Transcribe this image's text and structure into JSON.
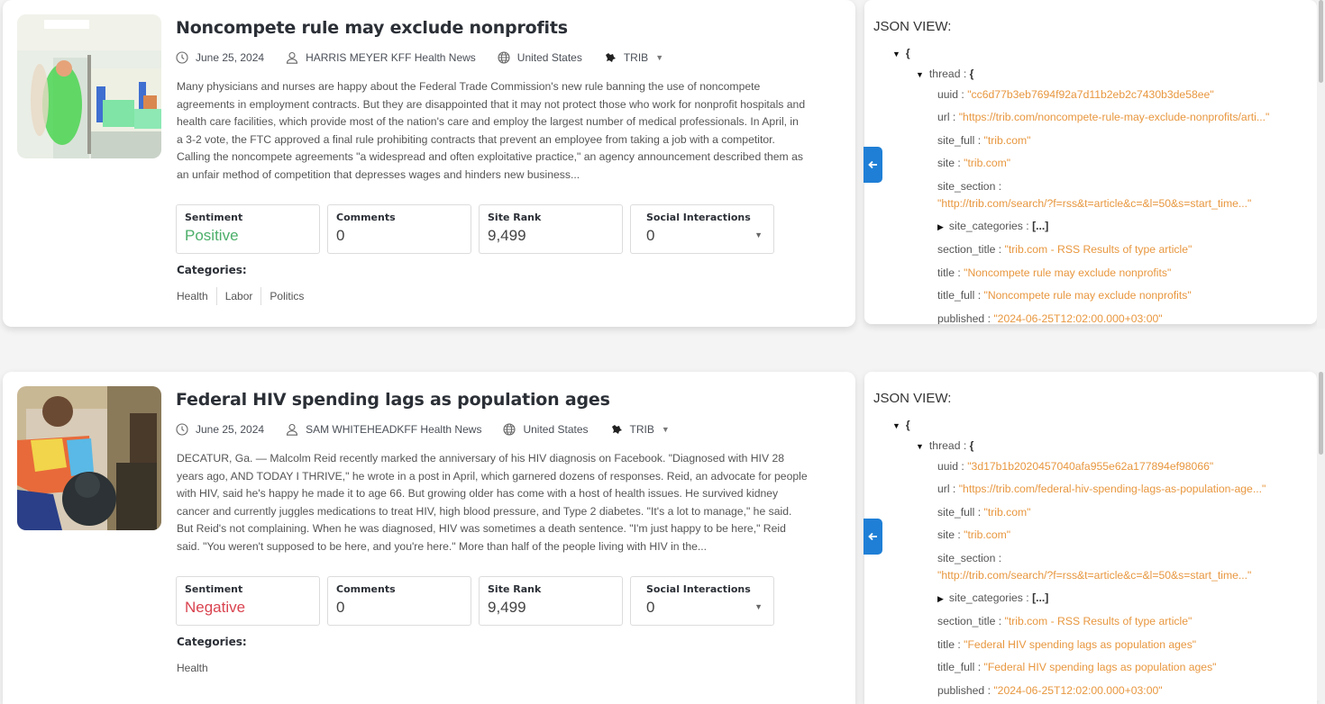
{
  "articles": [
    {
      "title": "Noncompete rule may exclude nonprofits",
      "date": "June 25, 2024",
      "author": "HARRIS MEYER KFF Health News",
      "country": "United States",
      "source": "TRIB",
      "image": "hospital-ward-photo",
      "summary": "Many physicians and nurses are happy about the Federal Trade Commission's new rule banning the use of noncompete agreements in employment contracts. But they are disappointed that it may not protect those who work for nonprofit hospitals and health care facilities, which provide most of the nation's care and employ the largest number of medical professionals. In April, in a 3-2 vote, the FTC approved a final rule prohibiting contracts that prevent an employee from taking a job with a competitor. Calling the noncompete agreements \"a widespread and often exploitative practice,\" an agency announcement described them as an unfair method of competition that depresses wages and hinders new business...",
      "stats": {
        "sentiment_label": "Sentiment",
        "sentiment": "Positive",
        "comments_label": "Comments",
        "comments": "0",
        "rank_label": "Site Rank",
        "rank": "9,499",
        "social_label": "Social Interactions",
        "social": "0"
      },
      "categories_label": "Categories:",
      "categories": [
        "Health",
        "Labor",
        "Politics"
      ],
      "json_view": {
        "header": "JSON VIEW:",
        "thread_key": "thread",
        "uuid": "\"cc6d77b3eb7694f92a7d11b2eb2c7430b3de58ee\"",
        "url": "\"https://trib.com/noncompete-rule-may-exclude-nonprofits/arti...\"",
        "site_full": "\"trib.com\"",
        "site": "\"trib.com\"",
        "site_section": "\"http://trib.com/search/?f=rss&t=article&c=&l=50&s=start_time...\"",
        "site_categories": "[...]",
        "section_title": "\"trib.com - RSS Results of type article\"",
        "title": "\"Noncompete rule may exclude nonprofits\"",
        "title_full": "\"Noncompete rule may exclude nonprofits\"",
        "published": "\"2024-06-25T12:02:00.000+03:00\""
      }
    },
    {
      "title": "Federal HIV spending lags as population ages",
      "date": "June 25, 2024",
      "author": "SAM WHITEHEADKFF Health News",
      "country": "United States",
      "source": "TRIB",
      "image": "man-with-dog-photo",
      "summary": "DECATUR, Ga. — Malcolm Reid recently marked the anniversary of his HIV diagnosis on Facebook. \"Diagnosed with HIV 28 years ago, AND TODAY I THRIVE,\" he wrote in a post in April, which garnered dozens of responses. Reid, an advocate for people with HIV, said he's happy he made it to age 66. But growing older has come with a host of health issues. He survived kidney cancer and currently juggles medications to treat HIV, high blood pressure, and Type 2 diabetes. \"It's a lot to manage,\" he said. But Reid's not complaining. When he was diagnosed, HIV was sometimes a death sentence. \"I'm just happy to be here,\" Reid said. \"You weren't supposed to be here, and you're here.\" More than half of the people living with HIV in the...",
      "stats": {
        "sentiment_label": "Sentiment",
        "sentiment": "Negative",
        "comments_label": "Comments",
        "comments": "0",
        "rank_label": "Site Rank",
        "rank": "9,499",
        "social_label": "Social Interactions",
        "social": "0"
      },
      "categories_label": "Categories:",
      "categories": [
        "Health"
      ],
      "json_view": {
        "header": "JSON VIEW:",
        "thread_key": "thread",
        "uuid": "\"3d17b1b2020457040afa955e62a177894ef98066\"",
        "url": "\"https://trib.com/federal-hiv-spending-lags-as-population-age...\"",
        "site_full": "\"trib.com\"",
        "site": "\"trib.com\"",
        "site_section": "\"http://trib.com/search/?f=rss&t=article&c=&l=50&s=start_time...\"",
        "site_categories": "[...]",
        "section_title": "\"trib.com - RSS Results of type article\"",
        "title": "\"Federal HIV spending lags as population ages\"",
        "title_full": "\"Federal HIV spending lags as population ages\"",
        "published": "\"2024-06-25T12:02:00.000+03:00\""
      }
    }
  ],
  "colors": {
    "positive": "#4caf6a",
    "negative": "#d9434f",
    "json_string": "#e8973f",
    "toggle": "#1f7fd6"
  }
}
